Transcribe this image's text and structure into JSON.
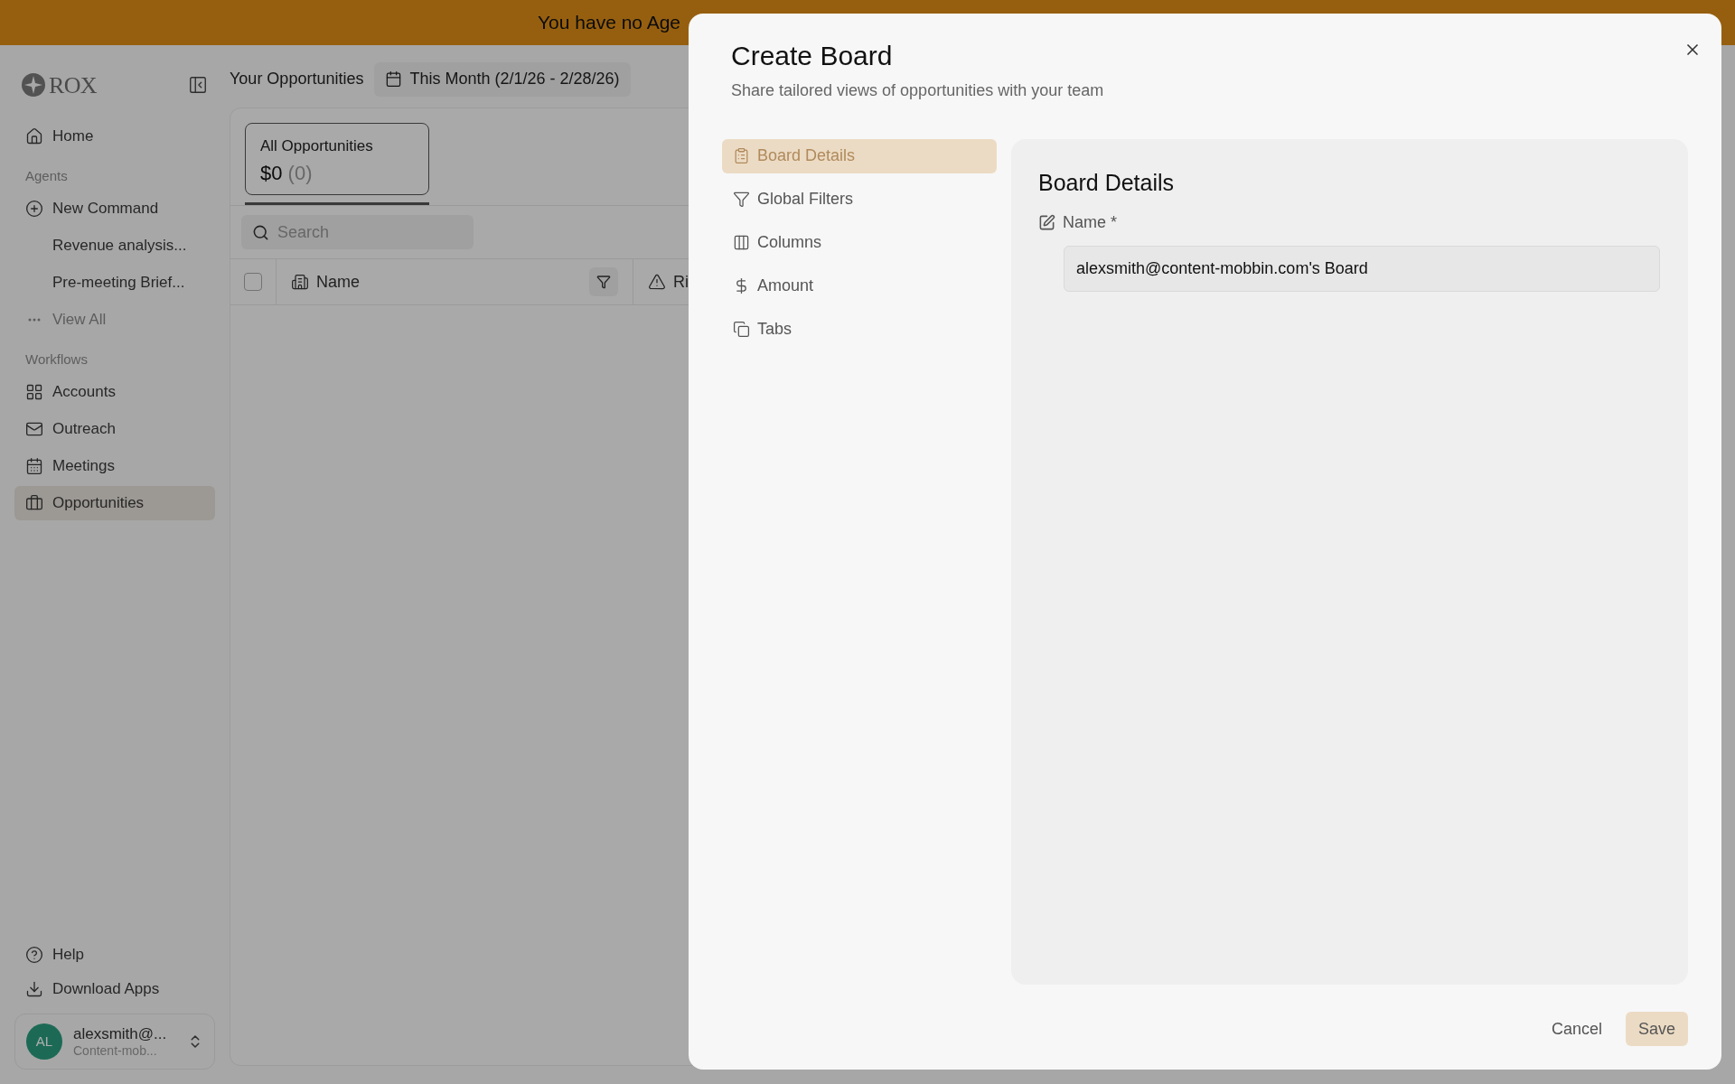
{
  "banner": {
    "text": "You have no Age"
  },
  "sidebar": {
    "logo": "ROX",
    "home": {
      "label": "Home",
      "selected": false
    },
    "sections": [
      {
        "heading": "Agents",
        "items": [
          {
            "label": "New Command",
            "kind": "action",
            "selected": false
          },
          {
            "label": "Revenue analysis...",
            "kind": "chat",
            "selected": false
          },
          {
            "label": "Pre-meeting Brief...",
            "kind": "chat",
            "selected": false
          },
          {
            "label": "View All",
            "kind": "more",
            "selected": false
          }
        ]
      },
      {
        "heading": "Workflows",
        "items": [
          {
            "label": "Accounts",
            "kind": "link",
            "selected": false
          },
          {
            "label": "Outreach",
            "kind": "link",
            "selected": false
          },
          {
            "label": "Meetings",
            "kind": "link",
            "selected": false
          },
          {
            "label": "Opportunities",
            "kind": "link",
            "selected": true
          }
        ]
      }
    ],
    "footer": [
      {
        "label": "Help"
      },
      {
        "label": "Download Apps"
      }
    ],
    "account": {
      "initials": "AL",
      "name": "alexsmith@...",
      "org": "Content-mob..."
    }
  },
  "header": {
    "title": "Your Opportunities",
    "date_range": "This Month (2/1/26 - 2/28/26)"
  },
  "tabs": [
    {
      "label": "All Opportunities",
      "amount": "$0",
      "count": "(0)",
      "selected": true
    }
  ],
  "search": {
    "placeholder": "Search"
  },
  "table": {
    "select_all_checked": false,
    "columns": [
      {
        "label": "Name"
      },
      {
        "label": "Ri"
      }
    ]
  },
  "modal": {
    "title": "Create Board",
    "subtitle": "Share tailored views of opportunities with your team",
    "nav": [
      {
        "label": "Board Details",
        "selected": true
      },
      {
        "label": "Global Filters",
        "selected": false
      },
      {
        "label": "Columns",
        "selected": false
      },
      {
        "label": "Amount",
        "selected": false
      },
      {
        "label": "Tabs",
        "selected": false
      }
    ],
    "panel": {
      "title": "Board Details",
      "field_label": "Name *",
      "field_value": "alexsmith@content-mobbin.com's Board"
    },
    "buttons": [
      {
        "label": "Cancel",
        "kind": "secondary"
      },
      {
        "label": "Save",
        "kind": "primary"
      }
    ]
  }
}
